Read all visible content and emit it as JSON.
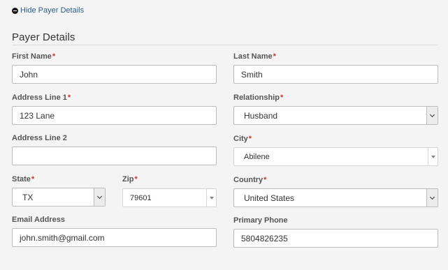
{
  "toggle": {
    "label": "Hide Payer Details"
  },
  "section": {
    "title": "Payer Details"
  },
  "required_marker": "*",
  "fields": {
    "first_name": {
      "label": "First Name",
      "value": "John"
    },
    "last_name": {
      "label": "Last Name",
      "value": "Smith"
    },
    "address1": {
      "label": "Address Line 1",
      "value": "123 Lane"
    },
    "relationship": {
      "label": "Relationship",
      "value": "Husband"
    },
    "address2": {
      "label": "Address Line 2",
      "value": ""
    },
    "city": {
      "label": "City",
      "value": "Abilene"
    },
    "state": {
      "label": "State",
      "value": "TX"
    },
    "zip": {
      "label": "Zip",
      "value": "79601"
    },
    "country": {
      "label": "Country",
      "value": "United States"
    },
    "email": {
      "label": "Email Address",
      "value": "john.smith@gmail.com"
    },
    "phone": {
      "label": "Primary Phone",
      "value": "5804826235"
    }
  },
  "colors": {
    "link": "#2a5d8f",
    "required": "#c0392b",
    "background": "#f4f4f4"
  },
  "icons": {
    "toggle": "minus-circle-icon",
    "select": "chevron-down-icon",
    "combo": "triangle-down-icon"
  }
}
